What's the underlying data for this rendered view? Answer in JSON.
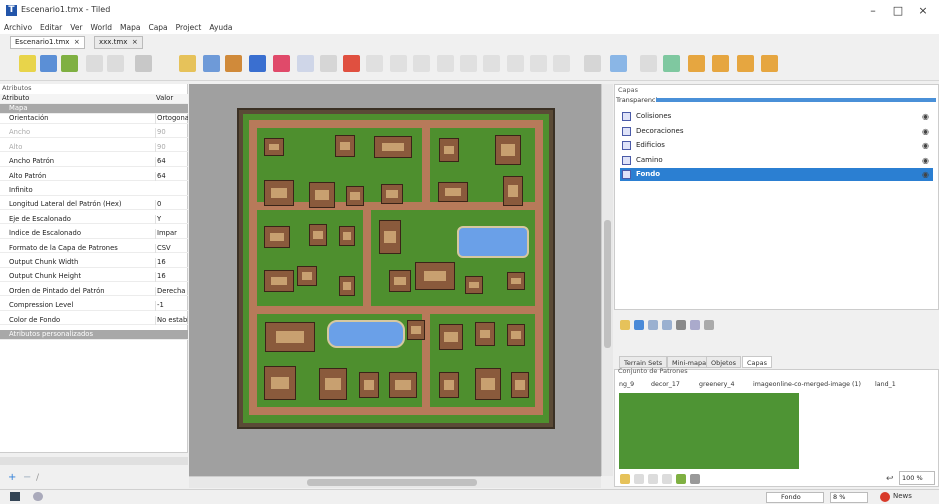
{
  "window": {
    "title": "Escenario1.tmx - Tiled",
    "icon": "tiled-logo-icon",
    "min": "–",
    "max": "□",
    "close": "×"
  },
  "menu": [
    "Archivo",
    "Editar",
    "Ver",
    "World",
    "Mapa",
    "Capa",
    "Project",
    "Ayuda"
  ],
  "doc_tabs": [
    {
      "label": "Escenario1.tmx",
      "close": "×"
    },
    {
      "label": "xxx.tmx",
      "close": "×"
    }
  ],
  "properties": {
    "panel_title": "Atributos",
    "col_key": "Atributo",
    "col_value": "Valor",
    "group_map": "Mapa",
    "rows": [
      {
        "k": "Orientación",
        "v": "Ortogonal",
        "dis": false
      },
      {
        "k": "Ancho",
        "v": "90",
        "dis": true
      },
      {
        "k": "Alto",
        "v": "90",
        "dis": true
      },
      {
        "k": "Ancho Patrón",
        "v": "64",
        "dis": false
      },
      {
        "k": "Alto Patrón",
        "v": "64",
        "dis": false
      },
      {
        "k": "Infinito",
        "v": "",
        "dis": false
      },
      {
        "k": "Longitud Lateral del Patrón (Hex)",
        "v": "0",
        "dis": false
      },
      {
        "k": "Eje de Escalonado",
        "v": "Y",
        "dis": false
      },
      {
        "k": "Índice de Escalonado",
        "v": "Impar",
        "dis": false
      },
      {
        "k": "Formato de la Capa de Patrones",
        "v": "CSV",
        "dis": false
      },
      {
        "k": "Output Chunk Width",
        "v": "16",
        "dis": false
      },
      {
        "k": "Output Chunk Height",
        "v": "16",
        "dis": false
      },
      {
        "k": "Orden de Pintado del Patrón",
        "v": "Derecha",
        "dis": false
      },
      {
        "k": "Compression Level",
        "v": "-1",
        "dis": false
      },
      {
        "k": "Color de Fondo",
        "v": "No establecido",
        "dis": false
      }
    ],
    "group_custom": "Atributos personalizados"
  },
  "layers": {
    "panel_title": "Capas",
    "opacity_label": "Transparencia:",
    "items": [
      {
        "name": "Colisiones",
        "selected": false
      },
      {
        "name": "Decoraciones",
        "selected": false
      },
      {
        "name": "Edificios",
        "selected": false
      },
      {
        "name": "Camino",
        "selected": false
      },
      {
        "name": "Fondo",
        "selected": true
      }
    ]
  },
  "panel_tabs": [
    "Terrain Sets",
    "Mini-mapa",
    "Objetos",
    "Capas"
  ],
  "tilesets": {
    "panel_title": "Conjunto de Patrones",
    "tabs": [
      "ng_9",
      "decor_17",
      "greenery_4",
      "imageonline-co-merged-image (1)",
      "land_1"
    ]
  },
  "zoom": "100 %",
  "statusbar": {
    "layer": "Fondo",
    "zoom": "8 %",
    "news": "News"
  },
  "colors": {
    "accent": "#2b7fd2",
    "grass": "#4e8f2e",
    "road": "#b77a5a",
    "water": "#6aa0e8"
  }
}
